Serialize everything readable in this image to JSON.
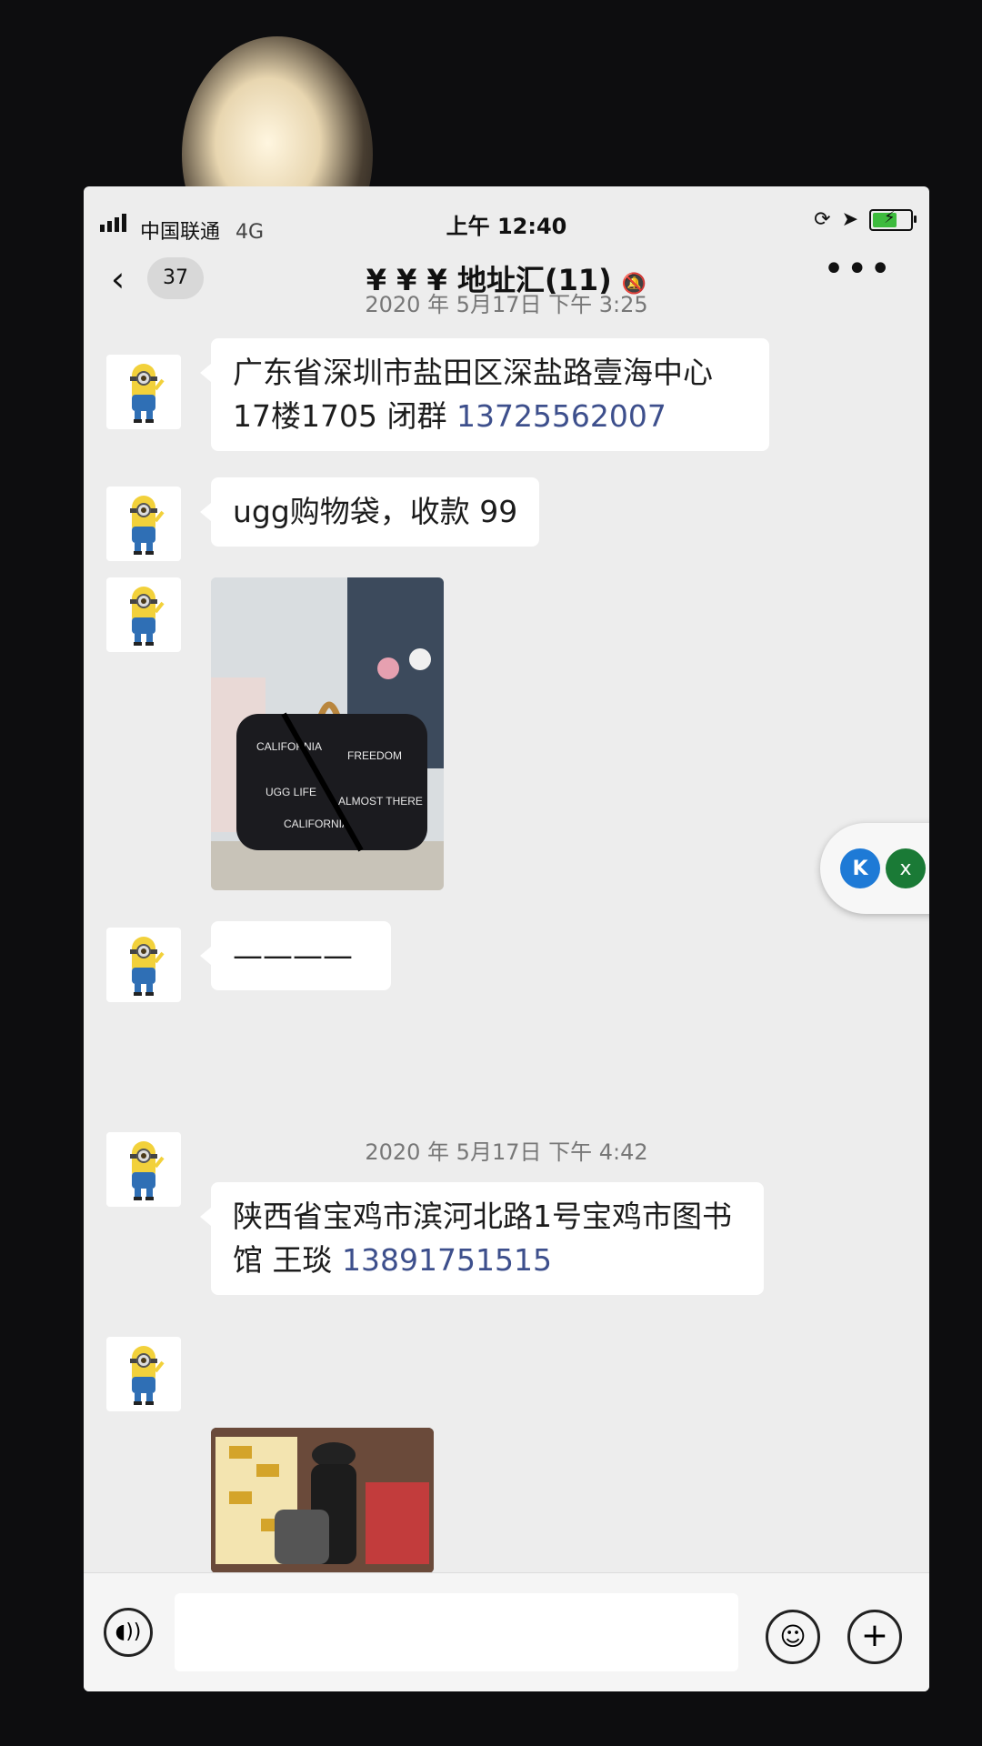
{
  "status": {
    "carrier": "中国联通",
    "network": "4G",
    "time": "上午 12:40"
  },
  "header": {
    "back_count": "37",
    "title": "¥ ¥ ¥ 地址汇(11)",
    "more": "•••"
  },
  "messages": [
    {
      "timestamp": "2020 年 5月17日  下午 3:25"
    },
    {
      "text": "广东省深圳市盐田区深盐路壹海中心17楼1705  闭群  ",
      "phone": "13725562007"
    },
    {
      "text": "ugg购物袋，收款 99"
    },
    {
      "image": "ugg-tote-bag-photo"
    },
    {
      "text": "————"
    },
    {
      "timestamp": "2020 年 5月17日  下午 4:42"
    },
    {
      "text": "陕西省宝鸡市滨河北路1号宝鸡市图书馆   王琰  ",
      "phone": "13891751515"
    },
    {
      "image": "shopper-photo"
    }
  ],
  "floating": {
    "left_icon": "K",
    "right_icon": "x"
  },
  "colors": {
    "phone_link": "#3d4f8c",
    "screen_bg": "#ededed",
    "bubble": "#ffffff"
  }
}
